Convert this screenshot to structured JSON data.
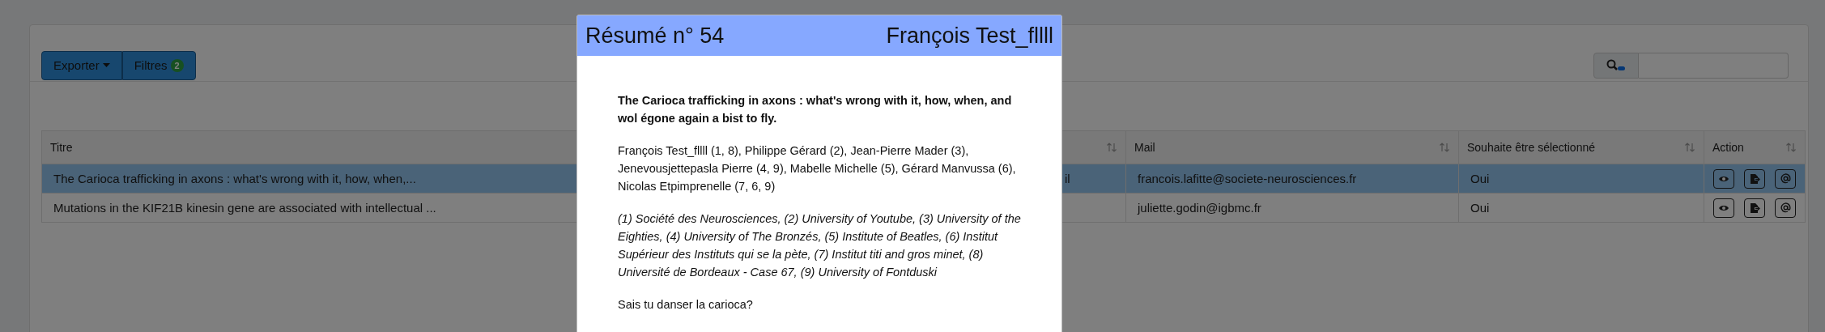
{
  "toolbar": {
    "export_button": "Exporter",
    "filters_button": "Filtres",
    "filters_count": "2"
  },
  "table": {
    "columns": [
      {
        "label": "Titre"
      },
      {
        "sortable": true
      },
      {
        "label": "Mail",
        "sortable": true
      },
      {
        "label": "Souhaite être sélectionné",
        "sortable": true
      },
      {
        "label": "Action",
        "sortable": true
      }
    ],
    "rows": [
      {
        "selected": true,
        "cells": [
          "The Carioca trafficking in axons : what's wrong with it, how, when,...",
          "il",
          "francois.lafitte@societe-neurosciences.fr",
          "Oui"
        ]
      },
      {
        "selected": false,
        "cells": [
          "Mutations in the KIF21B kinesin gene are associated with intellectual ...",
          "",
          "juliette.godin@igbmc.fr",
          "Oui"
        ]
      }
    ]
  },
  "modal": {
    "title": "Résumé n° 54",
    "author": "François Test_fllll",
    "abstract_title": "The Carioca trafficking in axons : what's wrong with it, how, when, and wol égone again a bist to fly.",
    "authors": "François Test_fllll (1, 8), Philippe Gérard (2), Jean-Pierre Mader (3), Jenevousjettepasla Pierre (4, 9), Mabelle Michelle (5), Gérard Manvussa (6), Nicolas Etpimprenelle (7, 6, 9)",
    "affiliations": "(1) Société des Neurosciences, (2) University of Youtube, (3) University of the Eighties, (4) University of The Bronzés, (5) Institute of Beatles, (6) Institut Supérieur des Instituts qui se la pète, (7) Institut titi and gros minet, (8) Université de Bordeaux - Case 67, (9) University of Fontduski",
    "body": "Sais tu danser la carioca?"
  }
}
